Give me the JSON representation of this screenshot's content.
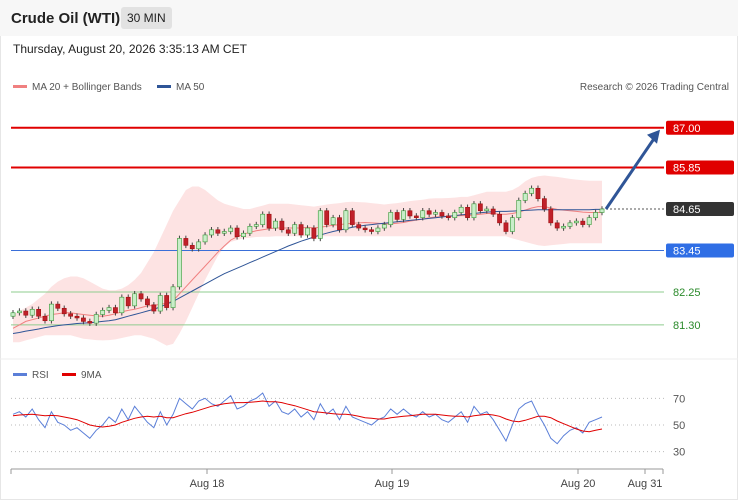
{
  "header": {
    "title": "Crude Oil (WTI)",
    "timeframe": "30 MIN"
  },
  "timestamp": "Thursday, August 20, 2026 3:35:13 AM CET",
  "credit": "Research © 2026 Trading Central",
  "legend_price": [
    {
      "label": "MA 20 + Bollinger Bands",
      "color": "#f08080"
    },
    {
      "label": "MA 50",
      "color": "#2f5597"
    }
  ],
  "legend_rsi": [
    {
      "label": "RSI",
      "color": "#5b7fd8"
    },
    {
      "label": "9MA",
      "color": "#e00000"
    }
  ],
  "chart_data": [
    {
      "type": "line",
      "ylim": [
        80.4,
        87.6
      ],
      "x_ticks": [
        "Aug 18",
        "Aug 19",
        "Aug 20",
        "Aug 31"
      ],
      "levels": [
        {
          "value": 87.0,
          "label": "87.00",
          "style": "resistance-red"
        },
        {
          "value": 85.85,
          "label": "85.85",
          "style": "resistance-red"
        },
        {
          "value": 84.65,
          "label": "84.65",
          "style": "last-price"
        },
        {
          "value": 83.45,
          "label": "83.45",
          "style": "support-blue"
        },
        {
          "value": 82.25,
          "label": "82.25",
          "style": "green-line"
        },
        {
          "value": 81.3,
          "label": "81.30",
          "style": "green-line"
        }
      ],
      "price_close": [
        81.65,
        81.7,
        81.58,
        81.75,
        81.55,
        81.42,
        81.9,
        81.78,
        81.62,
        81.55,
        81.5,
        81.4,
        81.35,
        81.6,
        81.72,
        81.8,
        81.65,
        82.1,
        81.85,
        82.2,
        82.05,
        81.88,
        81.7,
        82.15,
        81.8,
        82.4,
        83.8,
        83.6,
        83.5,
        83.7,
        83.9,
        84.05,
        83.95,
        84.0,
        84.1,
        83.85,
        83.95,
        84.15,
        84.2,
        84.5,
        84.1,
        84.3,
        84.05,
        83.95,
        84.2,
        83.9,
        84.1,
        83.8,
        84.6,
        84.2,
        84.4,
        84.05,
        84.6,
        84.2,
        84.1,
        84.05,
        84.0,
        84.1,
        84.2,
        84.55,
        84.35,
        84.6,
        84.45,
        84.4,
        84.6,
        84.5,
        84.55,
        84.45,
        84.4,
        84.55,
        84.7,
        84.4,
        84.8,
        84.6,
        84.65,
        84.5,
        84.25,
        84.0,
        84.4,
        84.9,
        85.1,
        85.25,
        84.95,
        84.65,
        84.25,
        84.1,
        84.15,
        84.25,
        84.3,
        84.2,
        84.4,
        84.55,
        84.65
      ],
      "ma20": [
        81.2,
        81.3,
        81.4,
        81.45,
        81.5,
        81.55,
        81.6,
        81.62,
        81.65,
        81.65,
        81.62,
        81.6,
        81.58,
        81.56,
        81.55,
        81.58,
        81.62,
        81.68,
        81.72,
        81.75,
        81.8,
        81.85,
        81.86,
        81.9,
        81.92,
        82.0,
        82.2,
        82.4,
        82.6,
        82.8,
        83.0,
        83.2,
        83.4,
        83.58,
        83.75,
        83.85,
        83.92,
        83.98,
        84.02,
        84.05,
        84.08,
        84.1,
        84.1,
        84.1,
        84.1,
        84.1,
        84.12,
        84.1,
        84.12,
        84.15,
        84.18,
        84.2,
        84.22,
        84.24,
        84.25,
        84.26,
        84.25,
        84.24,
        84.22,
        84.22,
        84.24,
        84.26,
        84.3,
        84.33,
        84.36,
        84.4,
        84.42,
        84.43,
        84.44,
        84.45,
        84.46,
        84.46,
        84.48,
        84.5,
        84.52,
        84.52,
        84.5,
        84.5,
        84.52,
        84.56,
        84.62,
        84.68,
        84.72,
        84.72,
        84.68,
        84.64,
        84.62,
        84.6,
        84.58,
        84.56,
        84.55,
        84.55,
        84.55
      ],
      "ma50": [
        81.05,
        81.08,
        81.12,
        81.15,
        81.18,
        81.22,
        81.25,
        81.28,
        81.3,
        81.32,
        81.34,
        81.35,
        81.36,
        81.38,
        81.4,
        81.42,
        81.45,
        81.5,
        81.55,
        81.6,
        81.65,
        81.7,
        81.75,
        81.82,
        81.9,
        81.98,
        82.08,
        82.18,
        82.28,
        82.38,
        82.48,
        82.58,
        82.68,
        82.78,
        82.86,
        82.94,
        83.02,
        83.1,
        83.18,
        83.26,
        83.34,
        83.42,
        83.5,
        83.58,
        83.65,
        83.72,
        83.78,
        83.84,
        83.9,
        83.95,
        84.0,
        84.04,
        84.08,
        84.12,
        84.15,
        84.18,
        84.2,
        84.22,
        84.24,
        84.26,
        84.28,
        84.3,
        84.32,
        84.34,
        84.36,
        84.38,
        84.4,
        84.42,
        84.44,
        84.46,
        84.48,
        84.5,
        84.52,
        84.54,
        84.56,
        84.57,
        84.58,
        84.58,
        84.59,
        84.6,
        84.61,
        84.62,
        84.63,
        84.63,
        84.63,
        84.63,
        84.63,
        84.63,
        84.63,
        84.63,
        84.63,
        84.64,
        84.64
      ],
      "bb_upper": [
        81.6,
        81.7,
        81.8,
        81.9,
        82.05,
        82.2,
        82.4,
        82.55,
        82.65,
        82.7,
        82.7,
        82.65,
        82.55,
        82.45,
        82.35,
        82.3,
        82.3,
        82.35,
        82.45,
        82.6,
        82.8,
        83.1,
        83.4,
        83.8,
        84.2,
        84.6,
        84.9,
        85.2,
        85.3,
        85.3,
        85.2,
        85.05,
        84.9,
        84.8,
        84.75,
        84.7,
        84.65,
        84.65,
        84.7,
        84.75,
        84.8,
        84.8,
        84.8,
        84.8,
        84.78,
        84.76,
        84.74,
        84.72,
        84.75,
        84.78,
        84.8,
        84.82,
        84.85,
        84.86,
        84.85,
        84.84,
        84.82,
        84.8,
        84.78,
        84.8,
        84.82,
        84.85,
        84.88,
        84.9,
        84.92,
        84.95,
        84.96,
        84.96,
        84.97,
        84.98,
        85.0,
        85.0,
        85.05,
        85.1,
        85.15,
        85.15,
        85.15,
        85.15,
        85.2,
        85.3,
        85.45,
        85.55,
        85.6,
        85.62,
        85.6,
        85.58,
        85.55,
        85.52,
        85.5,
        85.48,
        85.47,
        85.47,
        85.47
      ],
      "bb_lower": [
        80.8,
        80.8,
        80.85,
        80.9,
        80.95,
        81.0,
        81.0,
        81.0,
        81.0,
        81.0,
        80.95,
        80.9,
        80.88,
        80.86,
        80.85,
        80.86,
        80.88,
        80.92,
        80.96,
        81.0,
        81.0,
        80.95,
        80.9,
        80.8,
        80.7,
        80.75,
        81.05,
        81.4,
        81.8,
        82.2,
        82.6,
        82.95,
        83.3,
        83.55,
        83.7,
        83.75,
        83.8,
        83.82,
        83.84,
        83.85,
        83.85,
        83.86,
        83.86,
        83.86,
        83.86,
        83.86,
        83.86,
        83.86,
        83.86,
        83.86,
        83.86,
        83.86,
        83.86,
        83.86,
        83.86,
        83.86,
        83.86,
        83.86,
        83.86,
        83.86,
        83.86,
        83.86,
        83.86,
        83.86,
        83.86,
        83.86,
        83.86,
        83.86,
        83.86,
        83.86,
        83.86,
        83.86,
        83.86,
        83.86,
        83.86,
        83.86,
        83.86,
        83.86,
        83.8,
        83.75,
        83.7,
        83.65,
        83.6,
        83.58,
        83.6,
        83.62,
        83.64,
        83.66,
        83.66,
        83.66,
        83.66,
        83.66,
        83.66
      ],
      "arrow_target": 87.0
    },
    {
      "type": "line",
      "ylim": [
        20,
        80
      ],
      "y_ticks": [
        30,
        50,
        70
      ],
      "rsi": [
        58,
        60,
        56,
        62,
        54,
        48,
        60,
        52,
        50,
        46,
        48,
        44,
        40,
        46,
        50,
        56,
        52,
        62,
        54,
        64,
        58,
        52,
        48,
        60,
        50,
        58,
        70,
        66,
        62,
        68,
        70,
        66,
        64,
        68,
        72,
        62,
        64,
        68,
        70,
        74,
        64,
        68,
        60,
        58,
        62,
        56,
        60,
        54,
        66,
        58,
        62,
        54,
        64,
        56,
        54,
        52,
        50,
        54,
        56,
        62,
        58,
        62,
        58,
        56,
        60,
        56,
        58,
        54,
        52,
        56,
        60,
        52,
        64,
        58,
        60,
        54,
        46,
        38,
        50,
        62,
        66,
        68,
        58,
        50,
        40,
        36,
        42,
        46,
        48,
        44,
        52,
        54,
        56
      ],
      "ma9": [
        57,
        57.5,
        57.8,
        58,
        57.5,
        57,
        57.2,
        57,
        56,
        55,
        54,
        52,
        50,
        49,
        48.5,
        49,
        50,
        52,
        53.5,
        55,
        56,
        56.5,
        56,
        56.5,
        55.5,
        55.5,
        57,
        58.5,
        59.5,
        61,
        62.5,
        64,
        65,
        66,
        66.5,
        66.8,
        66.8,
        67,
        67.5,
        68,
        67.5,
        67.5,
        66.8,
        65.5,
        64.5,
        63,
        61.5,
        60,
        59.5,
        59,
        58.5,
        58,
        58,
        57.5,
        56.5,
        55.5,
        55,
        54.5,
        54.5,
        55.5,
        56,
        56.5,
        57,
        57.5,
        58,
        58,
        58,
        57.5,
        57,
        56.5,
        56.5,
        56,
        57,
        57.5,
        58,
        57.5,
        56.5,
        54.5,
        53,
        52.5,
        53.5,
        55,
        56.5,
        56.5,
        55.5,
        53,
        51,
        49,
        47,
        45.5,
        45,
        46,
        47
      ]
    }
  ]
}
